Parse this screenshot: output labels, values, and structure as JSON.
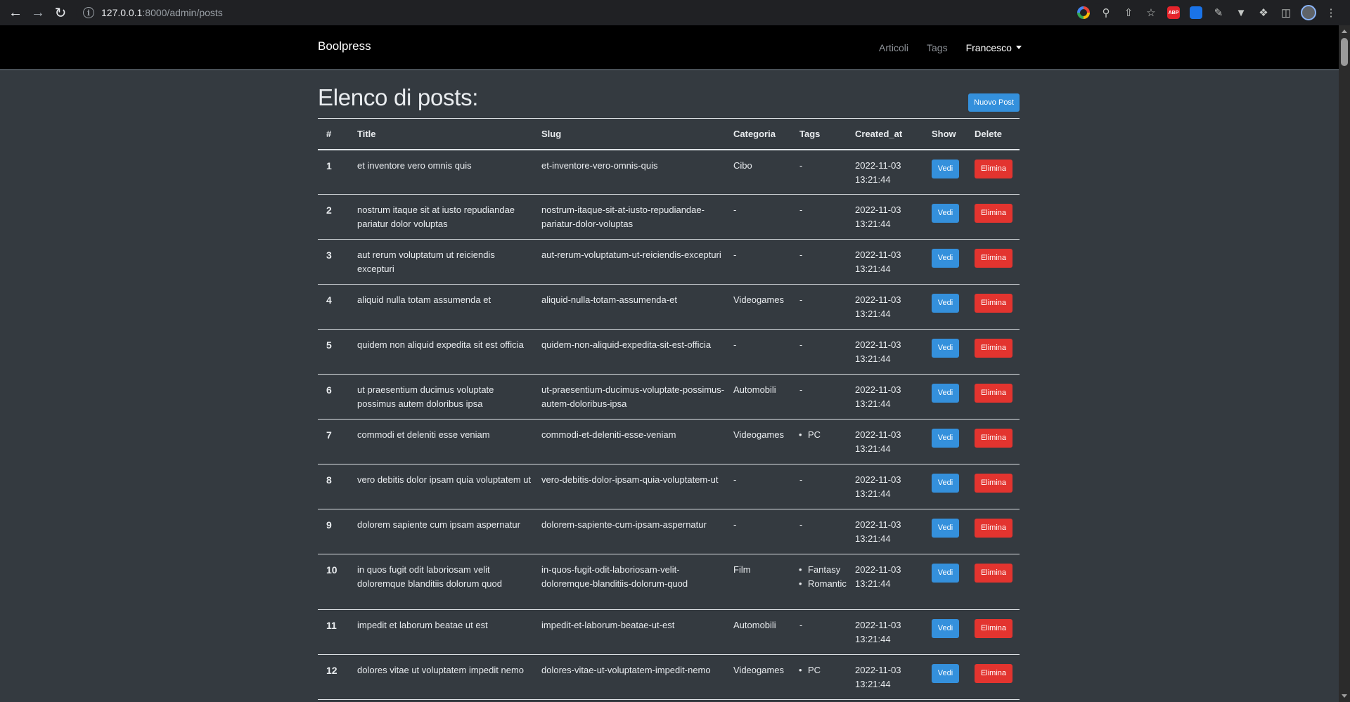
{
  "browser": {
    "url_host": "127.0.0.1",
    "url_path": ":8000/admin/posts"
  },
  "navbar": {
    "brand": "Boolpress",
    "links": [
      "Articoli",
      "Tags"
    ],
    "user": "Francesco"
  },
  "page": {
    "title": "Elenco di posts:",
    "new_button": "Nuovo Post"
  },
  "table": {
    "headers": [
      "#",
      "Title",
      "Slug",
      "Categoria",
      "Tags",
      "Created_at",
      "Show",
      "Delete"
    ],
    "show_label": "Vedi",
    "delete_label": "Elimina",
    "rows": [
      {
        "id": "1",
        "title": "et inventore vero omnis quis",
        "slug": "et-inventore-vero-omnis-quis",
        "category": "Cibo",
        "tags": [],
        "date": "2022-11-03",
        "time": "13:21:44"
      },
      {
        "id": "2",
        "title": "nostrum itaque sit at iusto repudiandae pariatur dolor voluptas",
        "slug": "nostrum-itaque-sit-at-iusto-repudiandae-pariatur-dolor-voluptas",
        "category": "-",
        "tags": [],
        "date": "2022-11-03",
        "time": "13:21:44"
      },
      {
        "id": "3",
        "title": "aut rerum voluptatum ut reiciendis excepturi",
        "slug": "aut-rerum-voluptatum-ut-reiciendis-excepturi",
        "category": "-",
        "tags": [],
        "date": "2022-11-03",
        "time": "13:21:44"
      },
      {
        "id": "4",
        "title": "aliquid nulla totam assumenda et",
        "slug": "aliquid-nulla-totam-assumenda-et",
        "category": "Videogames",
        "tags": [],
        "date": "2022-11-03",
        "time": "13:21:44"
      },
      {
        "id": "5",
        "title": "quidem non aliquid expedita sit est officia",
        "slug": "quidem-non-aliquid-expedita-sit-est-officia",
        "category": "-",
        "tags": [],
        "date": "2022-11-03",
        "time": "13:21:44"
      },
      {
        "id": "6",
        "title": "ut praesentium ducimus voluptate possimus autem doloribus ipsa",
        "slug": "ut-praesentium-ducimus-voluptate-possimus-autem-doloribus-ipsa",
        "category": "Automobili",
        "tags": [],
        "date": "2022-11-03",
        "time": "13:21:44"
      },
      {
        "id": "7",
        "title": "commodi et deleniti esse veniam",
        "slug": "commodi-et-deleniti-esse-veniam",
        "category": "Videogames",
        "tags": [
          "PC"
        ],
        "date": "2022-11-03",
        "time": "13:21:44"
      },
      {
        "id": "8",
        "title": "vero debitis dolor ipsam quia voluptatem ut",
        "slug": "vero-debitis-dolor-ipsam-quia-voluptatem-ut",
        "category": "-",
        "tags": [],
        "date": "2022-11-03",
        "time": "13:21:44"
      },
      {
        "id": "9",
        "title": "dolorem sapiente cum ipsam aspernatur",
        "slug": "dolorem-sapiente-cum-ipsam-aspernatur",
        "category": "-",
        "tags": [],
        "date": "2022-11-03",
        "time": "13:21:44"
      },
      {
        "id": "10",
        "title": "in quos fugit odit laboriosam velit doloremque blanditiis dolorum quod",
        "slug": "in-quos-fugit-odit-laboriosam-velit-doloremque-blanditiis-dolorum-quod",
        "category": "Film",
        "tags": [
          "Fantasy",
          "Romantic"
        ],
        "date": "2022-11-03",
        "time": "13:21:44"
      },
      {
        "id": "11",
        "title": "impedit et laborum beatae ut est",
        "slug": "impedit-et-laborum-beatae-ut-est",
        "category": "Automobili",
        "tags": [],
        "date": "2022-11-03",
        "time": "13:21:44"
      },
      {
        "id": "12",
        "title": "dolores vitae ut voluptatem impedit nemo",
        "slug": "dolores-vitae-ut-voluptatem-impedit-nemo",
        "category": "Videogames",
        "tags": [
          "PC"
        ],
        "date": "2022-11-03",
        "time": "13:21:44"
      }
    ]
  }
}
